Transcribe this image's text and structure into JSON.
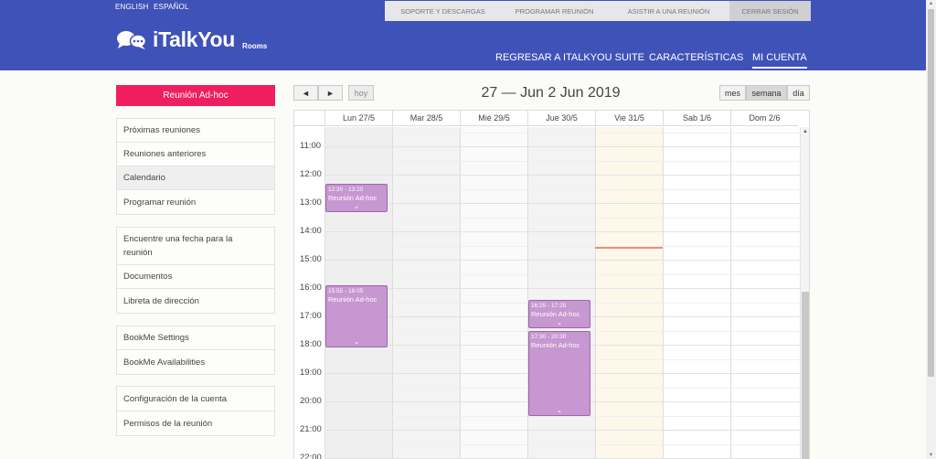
{
  "languages": [
    "ENGLISH",
    "ESPAÑOL"
  ],
  "top_nav": [
    {
      "label": "SOPORTE Y DESCARGAS"
    },
    {
      "label": "PROGRAMAR REUNIÓN"
    },
    {
      "label": "ASISTIR A UNA REUNIÓN"
    },
    {
      "label": "CERRAR SESIÓN"
    }
  ],
  "logo": {
    "text": "iTalkYou",
    "sub": "Rooms"
  },
  "main_nav": [
    {
      "label": "REGRESAR A ITALKYOU SUITE"
    },
    {
      "label": "CARACTERÍSTICAS"
    },
    {
      "label": "MI CUENTA"
    }
  ],
  "sidebar": {
    "adhoc_button": "Reunión Ad-hoc",
    "groups": [
      {
        "items": [
          "Próximas reuniones",
          "Reuniones anteriores",
          "Calendario",
          "Programar reunión"
        ]
      },
      {
        "items": [
          "Encuentre una fecha para la reunión",
          "Documentos",
          "Libreta de dirección"
        ]
      },
      {
        "items": [
          "BookMe Settings",
          "BookMe Availabilities"
        ]
      },
      {
        "items": [
          "Configuración de la cuenta",
          "Permisos de la reunión"
        ]
      }
    ]
  },
  "calendar": {
    "prev_label": "◄",
    "next_label": "►",
    "today_label": "hoy",
    "title": "27 — Jun 2 Jun 2019",
    "views": [
      "mes",
      "semana",
      "día"
    ],
    "active_view": "semana",
    "days": [
      "Lun 27/5",
      "Mar 28/5",
      "Mié 29/5",
      "Jue 30/5",
      "Vie 31/5",
      "Sab 1/6",
      "Dom 2/6"
    ],
    "today_index": 4,
    "hours": [
      "11:00",
      "12:00",
      "13:00",
      "14:00",
      "15:00",
      "16:00",
      "17:00",
      "18:00",
      "19:00",
      "20:00",
      "21:00",
      "22:00"
    ],
    "events": [
      {
        "day": 0,
        "time": "12:20 - 13:20",
        "title": "Reunión Ad-hoc",
        "start": 12.333,
        "end": 13.333
      },
      {
        "day": 0,
        "time": "15:55 - 18:05",
        "title": "Reunión Ad-hoc",
        "start": 15.917,
        "end": 18.083
      },
      {
        "day": 3,
        "time": "16:25 - 17:25",
        "title": "Reunión Ad-hoc",
        "start": 16.417,
        "end": 17.417
      },
      {
        "day": 3,
        "time": "17:30 - 20:30",
        "title": "Reunión Ad-hoc",
        "start": 17.5,
        "end": 20.5
      }
    ],
    "now_hour": 14.55
  },
  "colors": {
    "header": "#3f52b8",
    "accent": "#ef1f5f",
    "event": "#c697d0",
    "now_line": "#f08c7c"
  }
}
